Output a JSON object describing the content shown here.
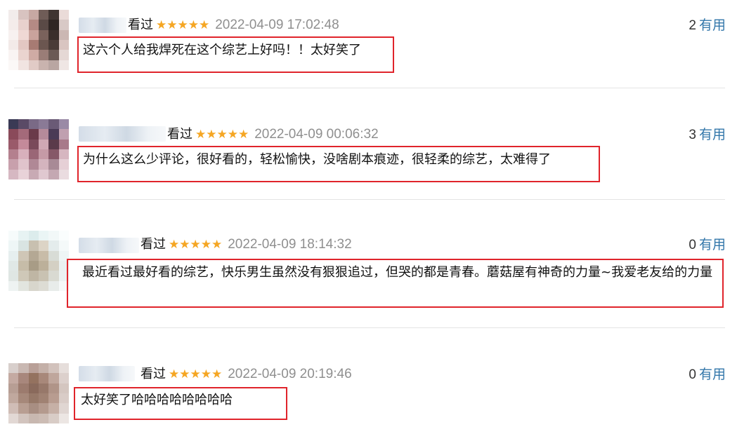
{
  "comments": [
    {
      "watched": "看过",
      "stars": "★★★★★",
      "time": "2022-04-09 17:02:48",
      "useful_count": "2",
      "useful_label": "有用",
      "text": "这六个人给我焊死在这个综艺上好吗！！太好笑了"
    },
    {
      "watched": "看过",
      "stars": "★★★★★",
      "time": "2022-04-09 00:06:32",
      "useful_count": "3",
      "useful_label": "有用",
      "text": "为什么这么少评论，很好看的，轻松愉快，没啥剧本痕迹，很轻柔的综艺，太难得了"
    },
    {
      "watched": "看过",
      "stars": "★★★★★",
      "time": "2022-04-09 18:14:32",
      "useful_count": "0",
      "useful_label": "有用",
      "text": "最近看过最好看的综艺，快乐男生虽然没有狠狠追过，但哭的都是青春。蘑菇屋有神奇的力量~我爱老友给的力量"
    },
    {
      "watched": "看过",
      "stars": "★★★★★",
      "time": "2022-04-09 20:19:46",
      "useful_count": "0",
      "useful_label": "有用",
      "text": "太好笑了哈哈哈哈哈哈哈哈"
    }
  ],
  "colors": {
    "star": "#f5a623",
    "highlight_border": "#e0242b",
    "useful_link": "#3377aa",
    "timestamp": "#8f8f8f"
  }
}
